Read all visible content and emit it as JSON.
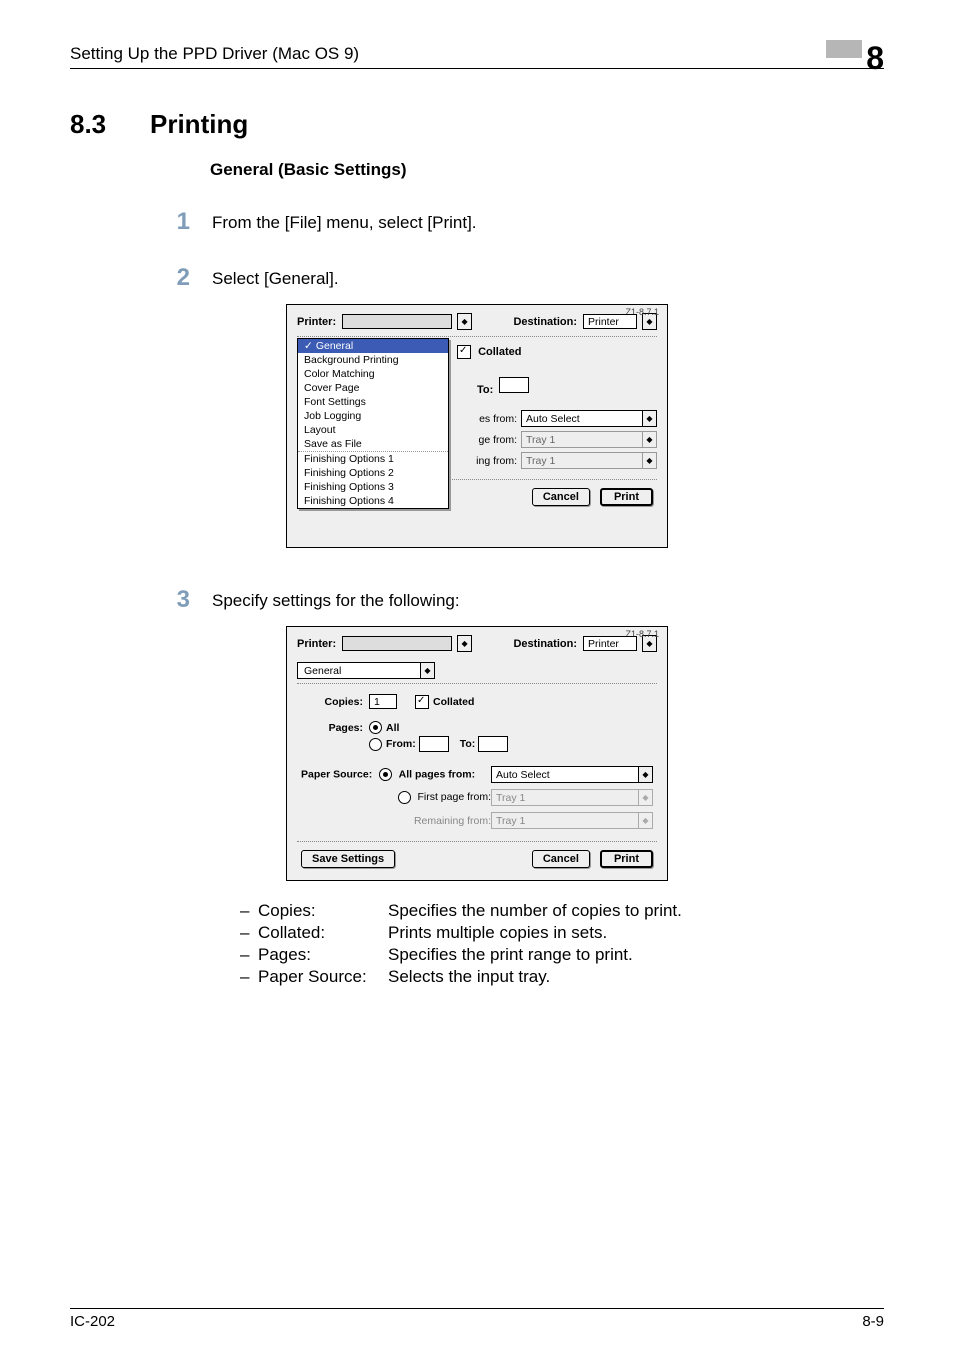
{
  "header": {
    "title": "Setting Up the PPD Driver (Mac OS 9)",
    "chapter": "8"
  },
  "section": {
    "number": "8.3",
    "title": "Printing"
  },
  "subhead": "General (Basic Settings)",
  "steps": {
    "s1": "From the [File] menu, select [Print].",
    "s2": "Select [General].",
    "s3": "Specify settings for the following:"
  },
  "dialog_common": {
    "version": "Z1-8.7.1",
    "printer_label": "Printer:",
    "destination_label": "Destination:",
    "destination_value": "Printer",
    "save_settings": "Save Settings",
    "cancel": "Cancel",
    "print": "Print"
  },
  "dialog1": {
    "menu": {
      "general": "General",
      "bg": "Background Printing",
      "color": "Color Matching",
      "cover": "Cover Page",
      "font": "Font Settings",
      "job": "Job Logging",
      "layout": "Layout",
      "save": "Save as File",
      "f1": "Finishing Options 1",
      "f2": "Finishing Options 2",
      "f3": "Finishing Options 3",
      "f4": "Finishing Options 4"
    },
    "collated": "Collated",
    "to": "To:",
    "lbl_es": "es from:",
    "lbl_ge": "ge from:",
    "lbl_ing": "ing from:",
    "val_auto": "Auto Select",
    "val_tray": "Tray 1"
  },
  "dialog2": {
    "panel_value": "General",
    "copies_label": "Copies:",
    "copies_value": "1",
    "collated": "Collated",
    "pages_label": "Pages:",
    "all_label": "All",
    "from_label": "From:",
    "to_label": "To:",
    "ps_label": "Paper Source:",
    "ps_all": "All pages from:",
    "ps_first": "First page from:",
    "ps_remaining": "Remaining from:",
    "val_auto": "Auto Select",
    "val_tray": "Tray 1"
  },
  "legend": {
    "l1_k": "Copies:",
    "l1_v": "Specifies the number of copies to print.",
    "l2_k": "Collated:",
    "l2_v": "Prints multiple copies in sets.",
    "l3_k": "Pages:",
    "l3_v": "Specifies the print range to print.",
    "l4_k": "Paper Source:",
    "l4_v": "Selects the input tray."
  },
  "footer": {
    "left": "IC-202",
    "right": "8-9"
  }
}
